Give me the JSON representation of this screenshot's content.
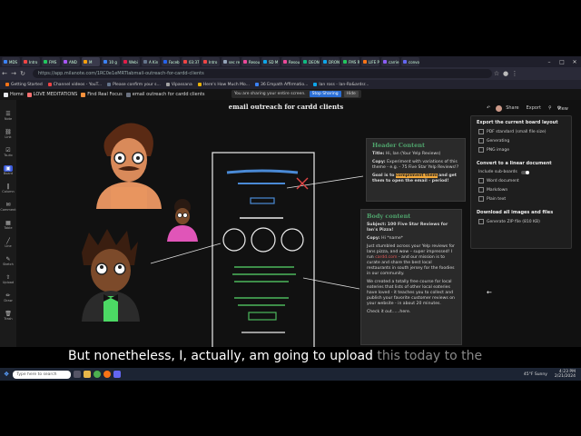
{
  "browser": {
    "tabs": [
      {
        "label": "MDS",
        "color": "#3b82f6"
      },
      {
        "label": "Intro",
        "color": "#ef4444"
      },
      {
        "label": "FMS",
        "color": "#22c55e"
      },
      {
        "label": "AND",
        "color": "#a855f7"
      },
      {
        "label": "M",
        "color": "#f59e0b",
        "active": true
      },
      {
        "label": "10 g",
        "color": "#3b82f6"
      },
      {
        "label": "Webi",
        "color": "#e11d48"
      },
      {
        "label": "A Kin",
        "color": "#64748b"
      },
      {
        "label": "Faceb",
        "color": "#2563eb"
      },
      {
        "label": "03:37",
        "color": "#ef4444"
      },
      {
        "label": "Intro",
        "color": "#ef4444"
      },
      {
        "label": "sec reco",
        "color": "#94a3b8"
      },
      {
        "label": "Resou",
        "color": "#ec4899"
      },
      {
        "label": "SD M",
        "color": "#0ea5e9"
      },
      {
        "label": "Resourc",
        "color": "#ec4899"
      },
      {
        "label": "DEON",
        "color": "#10b981"
      },
      {
        "label": "DRON",
        "color": "#0ea5e9"
      },
      {
        "label": "FMS R",
        "color": "#22c55e"
      },
      {
        "label": "LIFE PRO",
        "color": "#f97316"
      },
      {
        "label": "carrie",
        "color": "#8b5cf6"
      },
      {
        "label": "convo",
        "color": "#6366f1"
      }
    ],
    "url": "https://app.milanote.com/1RC0e1eMRTIabmail-outreach-for-cardd-clients",
    "bookmarks": [
      {
        "label": "Getting Started",
        "color": "#f97316"
      },
      {
        "label": "Channel videos - YouT...",
        "color": "#ef4444"
      },
      {
        "label": "Please confirm your s...",
        "color": "#64748b"
      },
      {
        "label": "Vipassana",
        "color": "#a3a3a3"
      },
      {
        "label": "Here's How Much Mo...",
        "color": "#eab308"
      },
      {
        "label": "36 Empath Affirmatio...",
        "color": "#3b82f6"
      },
      {
        "label": "lan ross - lan-Ro&ardsr...",
        "color": "#0ea5e9"
      }
    ]
  },
  "app": {
    "crumbs": [
      {
        "label": "Home",
        "color": "#e5e7eb"
      },
      {
        "label": "LOVE MEDITATIONS",
        "color": "#f87171"
      },
      {
        "label": "Find Real Focus",
        "color": "#fb923c"
      },
      {
        "label": "email outreach for cardd clients",
        "color": "#6b7280"
      }
    ],
    "share_notice": "You are sharing your entire screen.",
    "stop_sharing": "Stop Sharing",
    "hide": "Hide",
    "board_title": "email outreach for cardd clients",
    "toolbar": {
      "share": "Share",
      "export": "Export",
      "view": "View"
    },
    "leftbar": [
      "Note",
      "Link",
      "To-do",
      "Board",
      "Column",
      "Comment",
      "Table",
      "Line",
      "Sketch",
      "Upload",
      "Draw",
      "Trash"
    ]
  },
  "export_panel": {
    "heading1": "Export the current board layout",
    "items1": [
      "PDF standard (small file size)",
      "Generating",
      "PNG image"
    ],
    "heading2": "Convert to a linear document",
    "include_sub": "Include sub-boards",
    "items2": [
      "Word document",
      "Markdown",
      "Plain text"
    ],
    "heading3": "Download all images and files",
    "items3": [
      "Generate ZIP file (810 KB)"
    ]
  },
  "header_card": {
    "title": "Header Content",
    "title_line_label": "Title:",
    "title_line": "Hi, Ian (Your Yelp Reviews)",
    "copy_label": "Copy:",
    "copy": "Experiment with variations of this theme - e.g. - 75 Five Star Yelp Reviews!?",
    "goal_prefix": "Goal is to",
    "goal_highlight": "compliment them",
    "goal_suffix": "and get them to open the email - period!"
  },
  "body_card": {
    "title": "Body content",
    "subject_label": "Subject:",
    "subject": "100 Five Star Reviews for Ian's Pizza!",
    "copy_label": "Copy:",
    "copy": "Hi *name*",
    "p1a": "Just stumbled across your Yelp reviews for Ians pizza, and wow – super impressed! I run",
    "p1link": "cardd.com",
    "p1b": "- and our mission is to curate and share the best local restaurants in south jersey for the foodies in our community.",
    "p2": "We created a totally free course for local eateries that lists of other local eateries have loved - it teaches you to collect and publish your favorite customer reviews on your website - in about 20 minutes.",
    "p3": "Check it out......here."
  },
  "subtitle": {
    "bright": "But nonetheless, I, actually, am going to upload",
    "dim": "this today to the"
  },
  "taskbar": {
    "search": "Type here to search",
    "weather": "45°F Sunny",
    "time": "4:23 PM",
    "date": "2/21/2024"
  }
}
